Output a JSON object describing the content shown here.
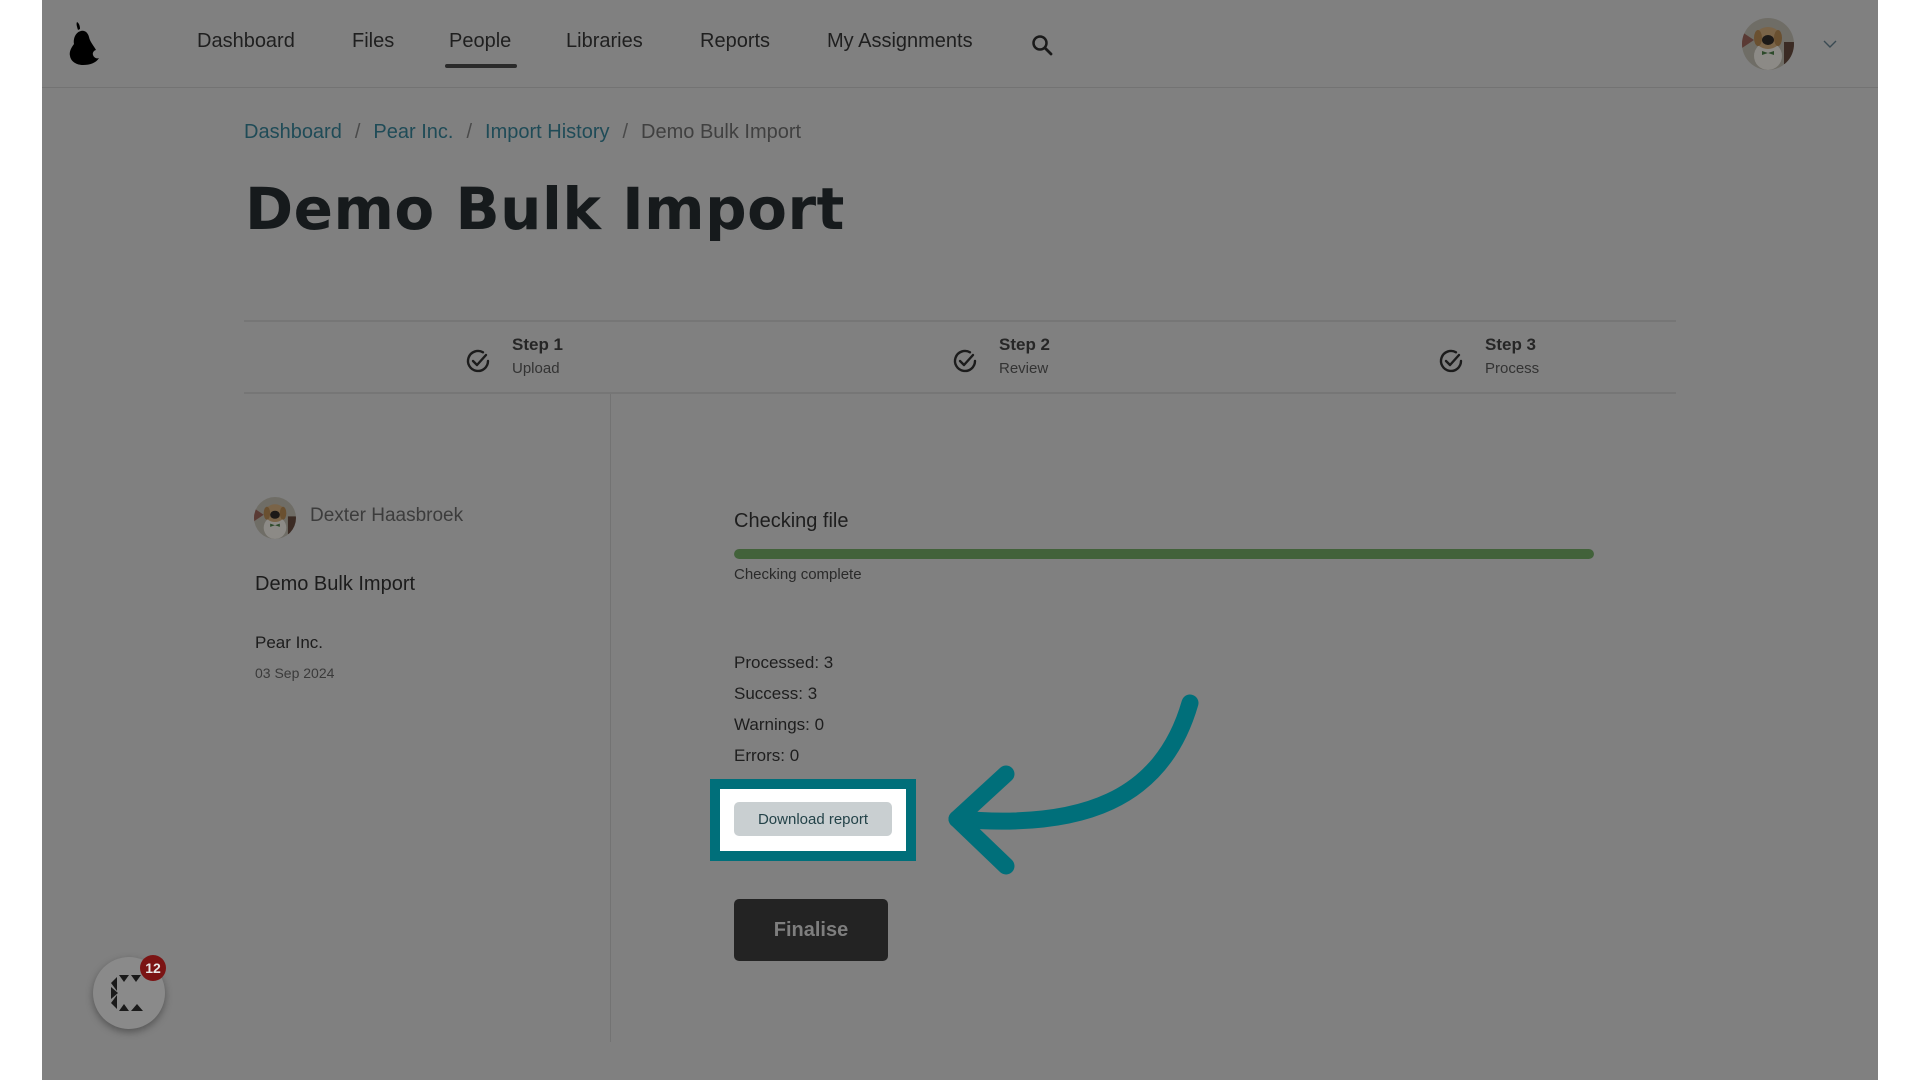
{
  "header": {
    "logo": "pear-logo-icon",
    "nav": [
      {
        "label": "Dashboard",
        "active": false
      },
      {
        "label": "Files",
        "active": false
      },
      {
        "label": "People",
        "active": true
      },
      {
        "label": "Libraries",
        "active": false
      },
      {
        "label": "Reports",
        "active": false
      },
      {
        "label": "My Assignments",
        "active": false
      }
    ],
    "search_icon": "search-icon",
    "user_menu_icon": "chevron-down-icon"
  },
  "breadcrumb": {
    "items": [
      "Dashboard",
      "Pear Inc.",
      "Import History"
    ],
    "separator": "/",
    "current": "Demo Bulk Import"
  },
  "page_title": "Demo Bulk Import",
  "steps": [
    {
      "title": "Step 1",
      "subtitle": "Upload",
      "status": "complete"
    },
    {
      "title": "Step 2",
      "subtitle": "Review",
      "status": "complete"
    },
    {
      "title": "Step 3",
      "subtitle": "Process",
      "status": "complete"
    }
  ],
  "summary": {
    "author": "Dexter Haasbroek",
    "import_name": "Demo Bulk Import",
    "organization": "Pear Inc.",
    "date": "03 Sep 2024"
  },
  "checking": {
    "title": "Checking file",
    "progress_percent": 100,
    "status": "Checking complete",
    "bar_color": "#42623a"
  },
  "stats": [
    "Processed: 3",
    "Success: 3",
    "Warnings: 0",
    "Errors: 0"
  ],
  "actions": {
    "download_report": "Download report",
    "finalise": "Finalise"
  },
  "annotation": {
    "highlight_color": "#006f7a"
  },
  "chat_widget": {
    "badge_count": "12"
  }
}
